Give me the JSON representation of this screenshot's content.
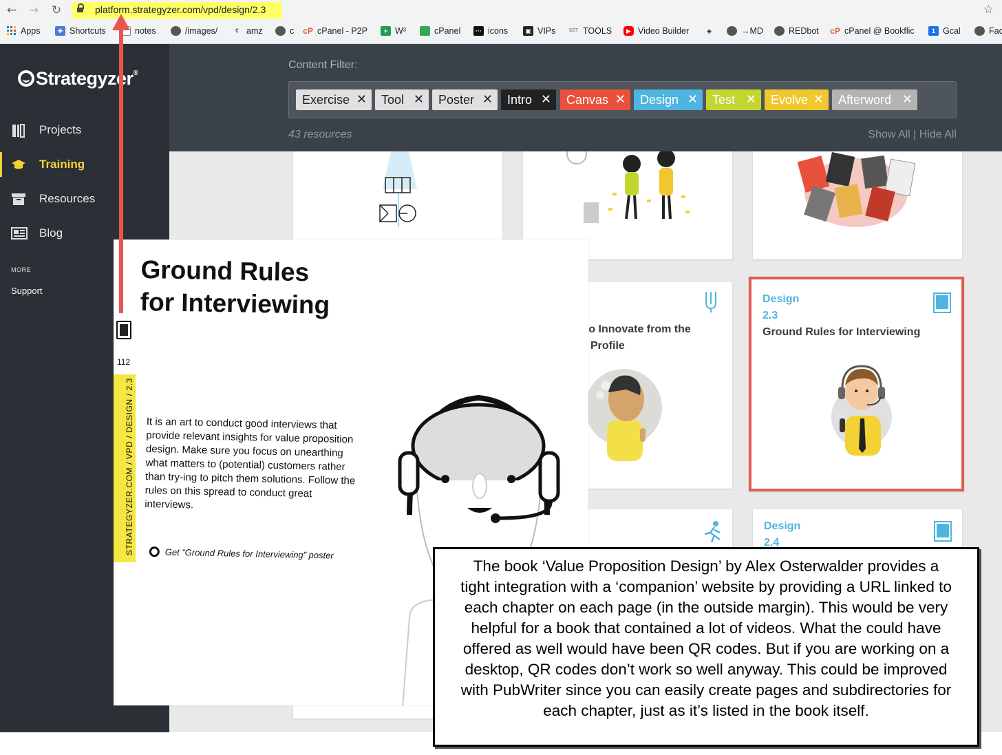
{
  "browser": {
    "url": "platform.strategyzer.com/vpd/design/2.3",
    "bookmarks": [
      {
        "label": "Apps",
        "icon": "apps-grid-icon"
      },
      {
        "label": "Shortcuts",
        "icon": "puzzle-icon"
      },
      {
        "label": "notes",
        "icon": "page-icon"
      },
      {
        "label": "/images/",
        "icon": "globe-icon"
      },
      {
        "label": "amz",
        "icon": "amz-icon"
      },
      {
        "label": "c",
        "icon": "globe-icon"
      },
      {
        "label": "cPanel - P2P",
        "icon": "cpanel-icon"
      },
      {
        "label": "W³",
        "icon": "sheets-icon"
      },
      {
        "label": "cPanel",
        "icon": "sheets-icon"
      },
      {
        "label": "icons",
        "icon": "icons-icon"
      },
      {
        "label": "VIPs",
        "icon": "vips-icon"
      },
      {
        "label": "TOOLS",
        "icon": "sst-icon"
      },
      {
        "label": "Video Builder",
        "icon": "youtube-icon"
      },
      {
        "label": "→MD",
        "icon": "globe-icon"
      },
      {
        "label": "REDbot",
        "icon": "globe-icon"
      },
      {
        "label": "cPanel @ Bookflic",
        "icon": "cpanel-icon"
      },
      {
        "label": "Gcal",
        "icon": "calendar-icon"
      },
      {
        "label": "Fac",
        "icon": "globe-icon"
      }
    ]
  },
  "sidebar": {
    "logo": "Strategyzer",
    "logo_mark": "®",
    "items": [
      {
        "label": "Projects",
        "icon": "projects-icon",
        "active": false
      },
      {
        "label": "Training",
        "icon": "graduation-cap-icon",
        "active": true
      },
      {
        "label": "Resources",
        "icon": "archive-box-icon",
        "active": false
      },
      {
        "label": "Blog",
        "icon": "newspaper-icon",
        "active": false
      }
    ],
    "more_label": "MORE",
    "support_label": "Support"
  },
  "filter": {
    "label": "Content Filter:",
    "tags": [
      {
        "label": "Exercise",
        "bg": "#e0e0e0",
        "fg": "#222222"
      },
      {
        "label": "Tool",
        "bg": "#e0e0e0",
        "fg": "#222222"
      },
      {
        "label": "Poster",
        "bg": "#e0e0e0",
        "fg": "#222222"
      },
      {
        "label": "Intro",
        "bg": "#222222",
        "fg": "#ffffff"
      },
      {
        "label": "Canvas",
        "bg": "#e8513c",
        "fg": "#ffffff"
      },
      {
        "label": "Design",
        "bg": "#4fb5e0",
        "fg": "#ffffff"
      },
      {
        "label": "Test",
        "bg": "#c3d630",
        "fg": "#ffffff"
      },
      {
        "label": "Evolve",
        "bg": "#f0c82e",
        "fg": "#ffffff"
      },
      {
        "label": "Afterword",
        "bg": "#b3b3b3",
        "fg": "#ffffff"
      }
    ],
    "count": "43 resources",
    "show_hide": "Show All | Hide All"
  },
  "cards": {
    "partial_title": "to Innovate from the",
    "partial_title_2": "Profile",
    "highlight": {
      "category": "Design",
      "number": "2.3",
      "title": "Ground Rules for Interviewing"
    },
    "lower": {
      "category": "Design",
      "number": "2.4"
    }
  },
  "book": {
    "title_line1": "Ground Rules",
    "title_line2": "for Interviewing",
    "page_number": "112",
    "strip_text": "STRATEGYZER.COM / VPD / DESIGN / 2.3",
    "body": "It is an art to conduct good interviews that provide relevant insights for value proposition design. Make sure you focus on unearthing what matters to (potential) customers rather than try-ing to pitch them solutions. Follow the rules on this spread to conduct great interviews.",
    "poster_line": "Get “Ground Rules for Interviewing” poster"
  },
  "callout": {
    "text": "The book ‘Value Proposition Design’ by Alex Osterwalder provides a tight integration with a ‘companion’ website by providing a URL linked to each chapter on each page (in the outside margin). This would be very helpful for a book that contained a lot of videos. What the could have offered as well would have been QR codes. But if you are working on a desktop, QR codes don’t work so well anyway. This could be improved with PubWriter since you can easily create pages and subdirectories for each chapter, just as it’s listed in the book itself."
  },
  "colors": {
    "accent_yellow": "#f5d234",
    "design_blue": "#4fb5e0",
    "highlight_red": "#e25b4f",
    "arrow_red": "#e8554e",
    "sidebar_bg": "#2b3036"
  }
}
